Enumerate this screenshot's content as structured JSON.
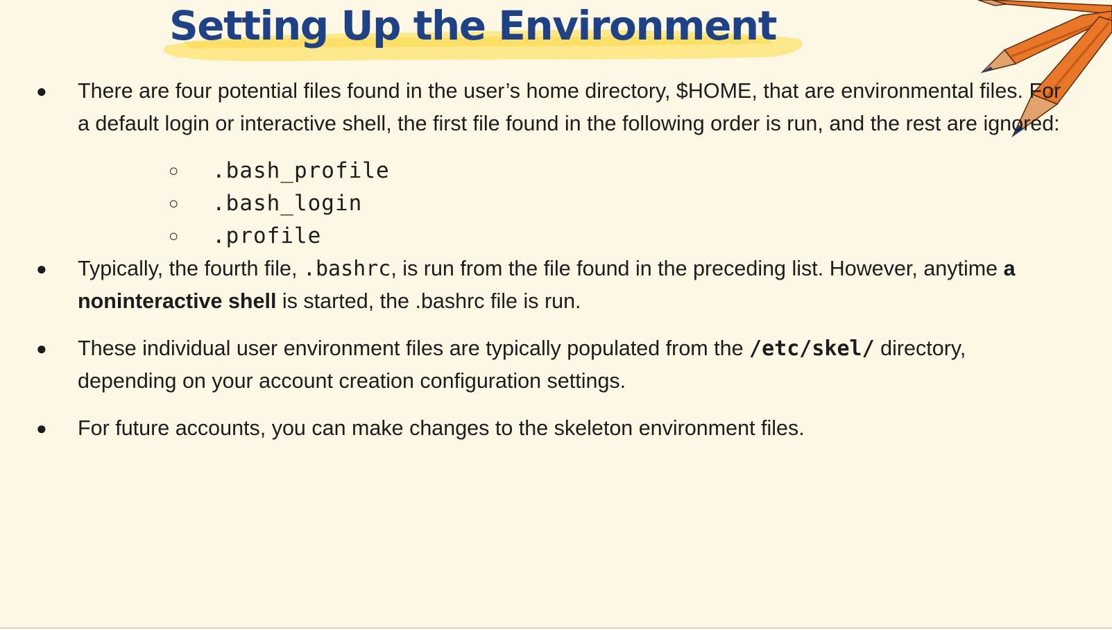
{
  "slide": {
    "title": "Setting Up the Environment",
    "colors": {
      "background": "#fdf8e6",
      "title": "#1f4287",
      "highlight": "#fde67a",
      "pencil_orange": "#e8772a",
      "pencil_wood": "#e2a46c",
      "pencil_tip": "#213a7a"
    },
    "decoration_icon": "pencils-icon",
    "bullets": [
      {
        "text": "There are four potential files found in the user’s home directory, $HOME, that are environmental files. For a default login or interactive shell, the first file found in the following order is run, and the rest are ignored:",
        "sub_items": [
          ".bash_profile",
          ".bash_login",
          ".profile"
        ]
      },
      {
        "part1": "Typically, the fourth file, ",
        "code": ".bashrc",
        "part2": ", is run from the file found in the preceding list. However, anytime ",
        "bold": "a noninteractive shell",
        "part3": " is started, the .bashrc file is run."
      },
      {
        "part1": "These individual user environment files are typically populated from the ",
        "code": "/etc/skel/",
        "part2": " directory, depending on your account creation configuration settings."
      },
      {
        "text": "For future accounts, you can make changes to the skeleton environment files."
      }
    ]
  }
}
